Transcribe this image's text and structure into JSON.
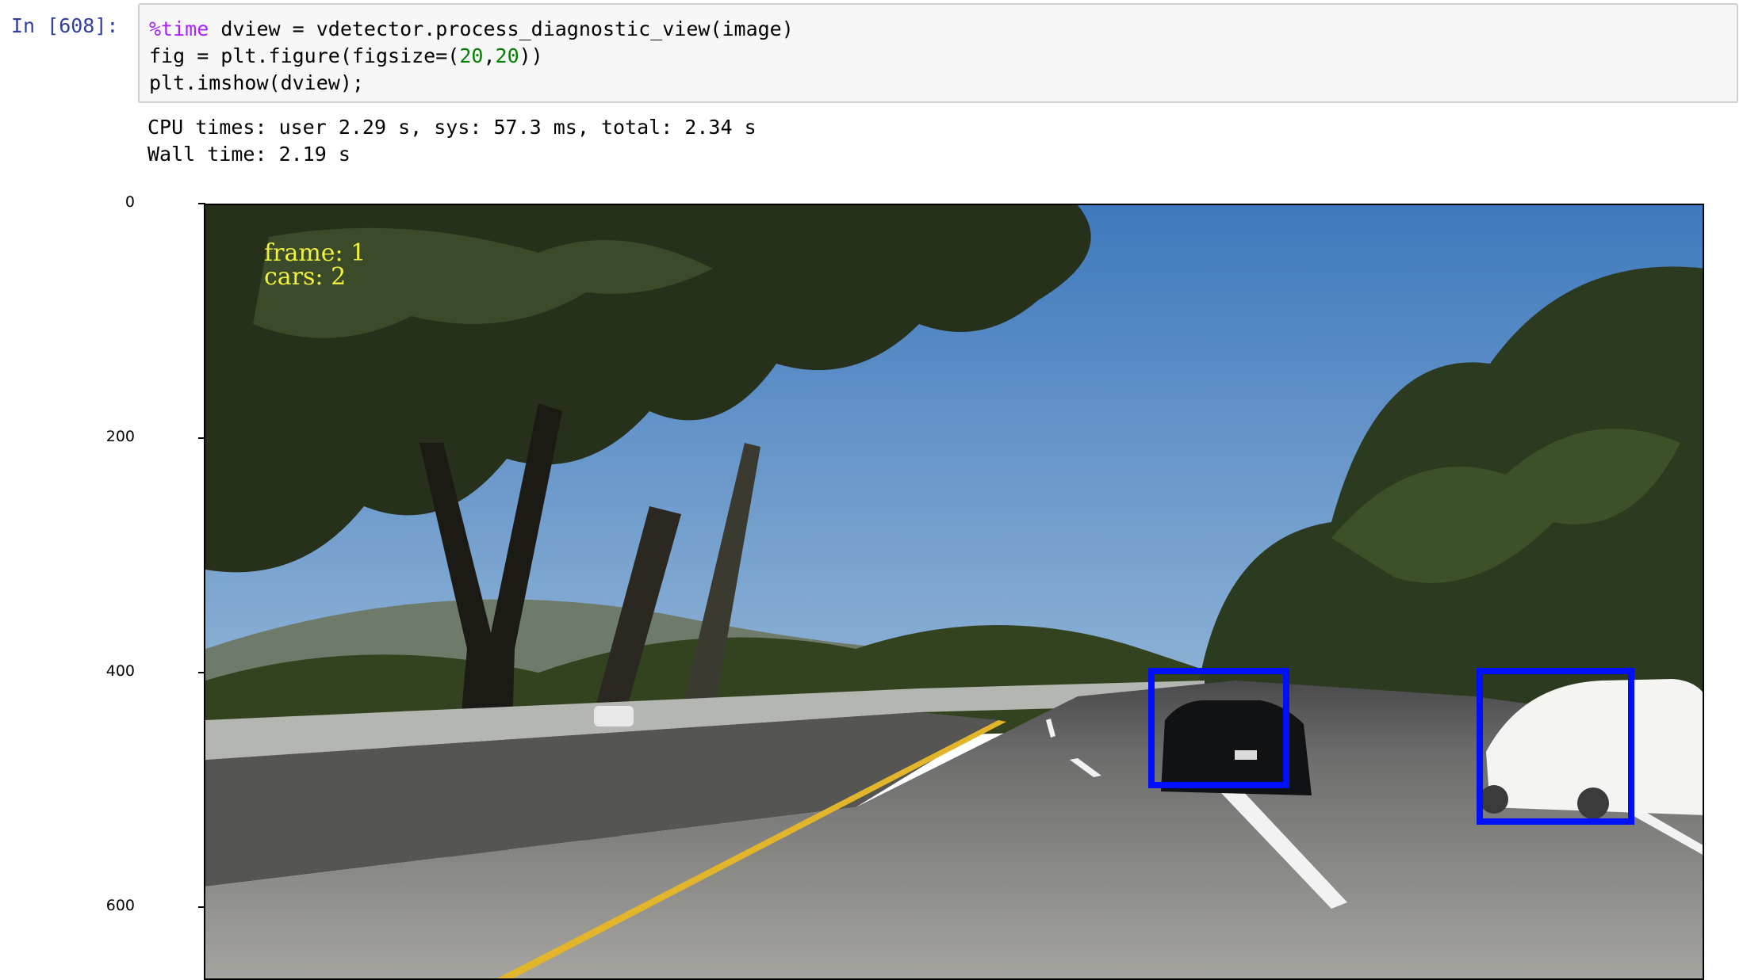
{
  "cell": {
    "prompt": "In [608]:",
    "code": {
      "line1_magic": "%time",
      "line1_rest": " dview = vdetector.process_diagnostic_view(image)",
      "line2_a": "fig = plt.figure(figsize=(",
      "line2_n1": "20",
      "line2_c": ",",
      "line2_n2": "20",
      "line2_b": "))",
      "line3": "plt.imshow(dview);"
    },
    "output": {
      "line1": "CPU times: user 2.29 s, sys: 57.3 ms, total: 2.34 s",
      "line2": "Wall time: 2.19 s"
    }
  },
  "plot": {
    "y_ticks": [
      "0",
      "200",
      "400",
      "600"
    ],
    "overlay": {
      "frame_text": "frame: 1",
      "cars_text": "cars: 2"
    },
    "detections": {
      "count": 2,
      "box_color": "#0010ff"
    },
    "colors": {
      "sky": "#5b8fc9",
      "trees": "#2b3a1a",
      "road": "#8a8a86",
      "lane_yellow": "#e3b52a"
    }
  }
}
